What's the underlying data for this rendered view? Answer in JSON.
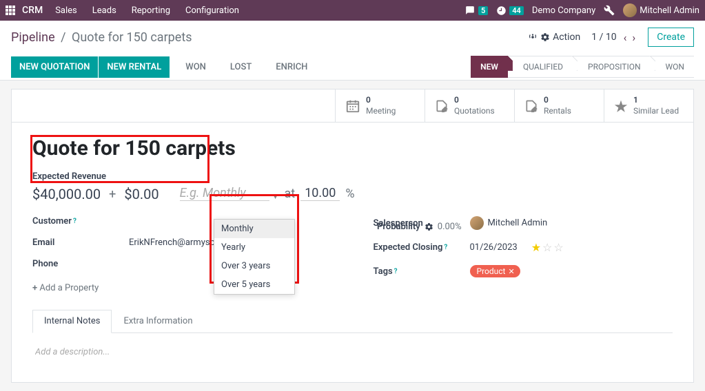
{
  "nav": {
    "brand": "CRM",
    "menus": [
      "Sales",
      "Leads",
      "Reporting",
      "Configuration"
    ],
    "msg_count": "5",
    "timer": "44",
    "company": "Demo Company",
    "user": "Mitchell Admin"
  },
  "cp": {
    "breadcrumb_root": "Pipeline",
    "breadcrumb_current": "Quote for 150 carpets",
    "action_label": "Action",
    "pager": "1 / 10",
    "create": "Create",
    "buttons": {
      "new_quotation": "NEW QUOTATION",
      "new_rental": "NEW RENTAL",
      "won": "WON",
      "lost": "LOST",
      "enrich": "ENRICH"
    },
    "stages": [
      "NEW",
      "QUALIFIED",
      "PROPOSITION",
      "WON"
    ]
  },
  "stats": {
    "meeting_n": "0",
    "meeting_l": "Meeting",
    "quotes_n": "0",
    "quotes_l": "Quotations",
    "rentals_n": "0",
    "rentals_l": "Rentals",
    "similar_n": "1",
    "similar_l": "Similar Lead"
  },
  "record": {
    "title": "Quote for 150 carpets",
    "expected_revenue_label": "Expected Revenue",
    "expected_revenue": "$40,000.00",
    "plus": "+",
    "recurring_value": "$0.00",
    "recurring_placeholder": "E.g. Monthly",
    "at": "at",
    "probability_label": "Probability",
    "probability_percent_value": "10.00",
    "probability_value": "0.00%",
    "percent_sign": "%",
    "customer_label": "Customer",
    "email_label": "Email",
    "email_value": "ErikNFrench@armyspy.com",
    "phone_label": "Phone",
    "add_property": "Add a Property",
    "salesperson_label": "Salesperson",
    "salesperson_value": "Mitchell Admin",
    "expected_closing_label": "Expected Closing",
    "expected_closing_value": "01/26/2023",
    "tags_label": "Tags",
    "tag_value": "Product"
  },
  "dropdown": [
    "Monthly",
    "Yearly",
    "Over 3 years",
    "Over 5 years"
  ],
  "notebook": {
    "tab1": "Internal Notes",
    "tab2": "Extra Information",
    "desc_placeholder": "Add a description..."
  }
}
